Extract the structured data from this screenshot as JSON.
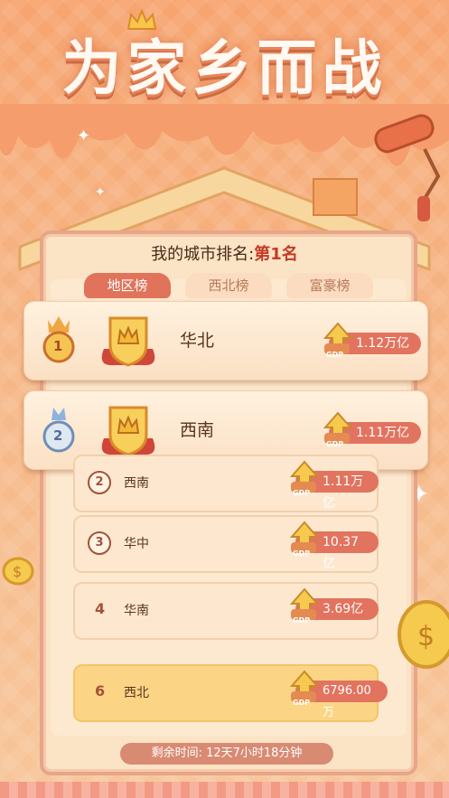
{
  "header": {
    "title": "为家乡而战"
  },
  "my_rank": {
    "prefix": "我的城市排名:",
    "value": "第1名"
  },
  "tabs": [
    {
      "label": "地区榜",
      "active": true
    },
    {
      "label": "西北榜",
      "active": false
    },
    {
      "label": "富豪榜",
      "active": false
    }
  ],
  "gdp_label": "GDP",
  "top_cards": [
    {
      "rank": "1",
      "name": "华北",
      "value": "1.12万亿"
    },
    {
      "rank": "2",
      "name": "西南",
      "value": "1.11万亿"
    }
  ],
  "list_cards": [
    {
      "rank": "2",
      "name": "西南",
      "value": "1.11万亿",
      "style": "circle"
    },
    {
      "rank": "3",
      "name": "华中",
      "value": "10.37亿",
      "style": "circle"
    },
    {
      "rank": "4",
      "name": "华南",
      "value": "3.69亿",
      "style": "plain"
    },
    {
      "rank": "6",
      "name": "西北",
      "value": "6796.00万",
      "style": "mine"
    }
  ],
  "footer": {
    "timer": "剩余时间: 12天7小时18分钟"
  },
  "colors": {
    "accent": "#e2735f",
    "highlight": "#c63a24",
    "mine_row": "#fbd585"
  }
}
